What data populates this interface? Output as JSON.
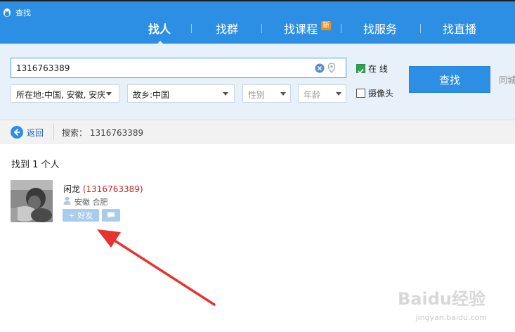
{
  "window": {
    "title": "查找"
  },
  "tabs": [
    {
      "label": "找人",
      "active": true
    },
    {
      "label": "找群"
    },
    {
      "label": "找课程",
      "badge": "新"
    },
    {
      "label": "找服务"
    },
    {
      "label": "找直播"
    }
  ],
  "search": {
    "query": "1316763389",
    "location": "所在地:中国, 安徽, 安庆",
    "hometown": "故乡:中国",
    "gender_placeholder": "性别",
    "age_placeholder": "年龄",
    "online_label": "在  线",
    "online_checked": true,
    "camera_label": "摄像头",
    "camera_checked": false,
    "button_label": "查找",
    "same_city_label": "同城"
  },
  "breadcrumb": {
    "back_label": "返回",
    "search_label": "搜索：",
    "search_term": "1316763389"
  },
  "results": {
    "count_text": "找到 1 个人",
    "items": [
      {
        "name": "闲龙",
        "qq_id": "(1316763389)",
        "location": "安徽 合肥",
        "add_label": "+ 好友"
      }
    ]
  },
  "watermark": {
    "brand": "Baidu经验",
    "url": "jingyan.baidu.com"
  },
  "colors": {
    "accent": "#2d8fe3",
    "highlight_id": "#c0281e",
    "annotation": "#e8322e"
  }
}
